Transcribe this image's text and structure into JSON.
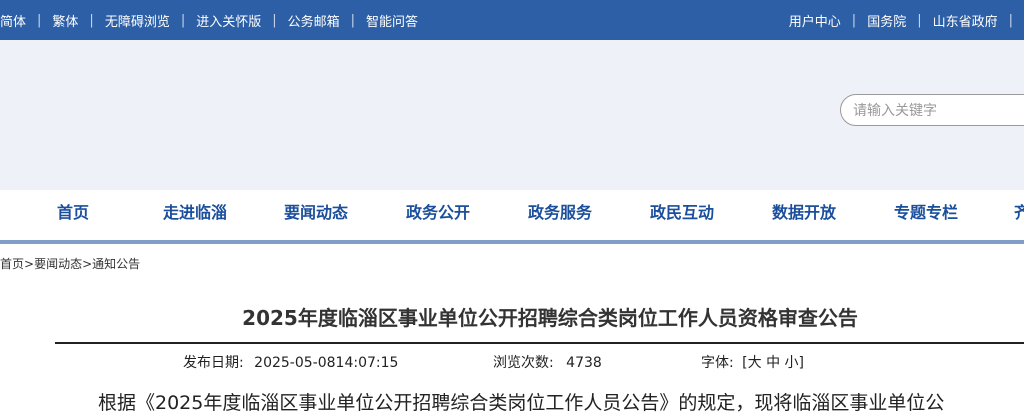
{
  "topbar": {
    "left_links": [
      "简体",
      "繁体",
      "无障碍浏览",
      "进入关怀版",
      "公务邮箱",
      "智能问答"
    ],
    "right_links": [
      "用户中心",
      "国务院",
      "山东省政府"
    ],
    "separator": "|"
  },
  "search": {
    "placeholder": "请输入关键字",
    "value": ""
  },
  "nav": {
    "items": [
      "首页",
      "走进临淄",
      "要闻动态",
      "政务公开",
      "政务服务",
      "政民互动",
      "数据开放",
      "专题专栏",
      "齐"
    ]
  },
  "breadcrumb": {
    "items": [
      "首页",
      "要闻动态",
      "通知公告"
    ],
    "separator": ">"
  },
  "article": {
    "title": "2025年度临淄区事业单位公开招聘综合类岗位工作人员资格审查公告",
    "date_label": "发布日期:",
    "date_value": "2025-05-0814:07:15",
    "views_label": "浏览次数:",
    "views_value": "4738",
    "font_label": "字体:",
    "font_open": "[",
    "font_large": "大",
    "font_medium": "中",
    "font_small": "小",
    "font_close": "]",
    "first_line": "根据《2025年度临淄区事业单位公开招聘综合类岗位工作人员公告》的规定，现将临淄区事业单位公"
  },
  "colors": {
    "topbar_bg": "#2d5fa6",
    "header_bg": "#eef2f8",
    "nav_text": "#1b4f9c",
    "nav_underline": "#7f9dc7"
  }
}
